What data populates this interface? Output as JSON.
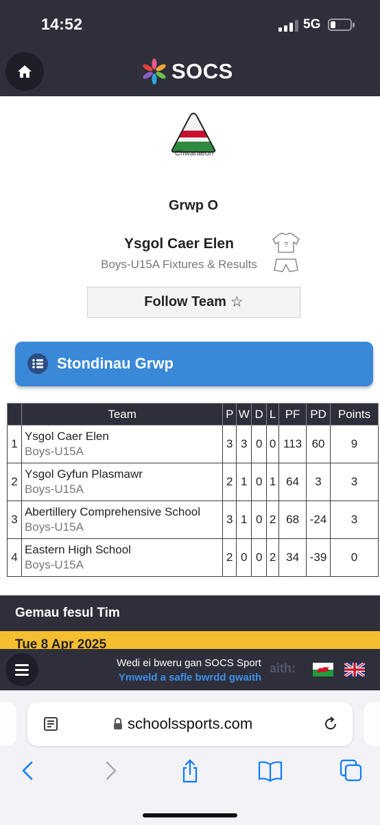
{
  "status_bar": {
    "time": "14:52",
    "network": "5G",
    "battery_level": 0.2
  },
  "app_header": {
    "home_icon": "home-icon",
    "logo_text": "SOCS"
  },
  "crest": {
    "caption": "Chwaraeon",
    "colors": [
      "#2f8a3f",
      "#c8112e",
      "#f2f2f2"
    ]
  },
  "group": {
    "name": "Grwp O"
  },
  "team": {
    "name": "Ysgol Caer Elen",
    "subtitle": "Boys-U15A Fixtures & Results",
    "kit_icons": [
      "shirt-icon",
      "shorts-icon"
    ],
    "shirt_mark": "?"
  },
  "follow_button": {
    "label": "Follow Team",
    "icon": "star-icon"
  },
  "standings_banner": {
    "label": "Stondinau Grwp",
    "icon": "list-icon",
    "color": "#3a89d9"
  },
  "standings": {
    "headers": [
      "",
      "Team",
      "P",
      "W",
      "D",
      "L",
      "PF",
      "PD",
      "Points"
    ],
    "rows": [
      {
        "pos": "1",
        "team": "Ysgol Caer Elen",
        "sub": "Boys-U15A",
        "p": "3",
        "w": "3",
        "d": "0",
        "l": "0",
        "pf": "113",
        "pd": "60",
        "points": "9"
      },
      {
        "pos": "2",
        "team": "Ysgol Gyfun Plasmawr",
        "sub": "Boys-U15A",
        "p": "2",
        "w": "1",
        "d": "0",
        "l": "1",
        "pf": "64",
        "pd": "3",
        "points": "3"
      },
      {
        "pos": "3",
        "team": "Abertillery Comprehensive School",
        "sub": "Boys-U15A",
        "p": "3",
        "w": "1",
        "d": "0",
        "l": "2",
        "pf": "68",
        "pd": "-24",
        "points": "3"
      },
      {
        "pos": "4",
        "team": "Eastern High School",
        "sub": "Boys-U15A",
        "p": "2",
        "w": "0",
        "d": "0",
        "l": "2",
        "pf": "34",
        "pd": "-39",
        "points": "0"
      }
    ]
  },
  "fixtures": {
    "section_title": "Gemau fesul Tim",
    "date": "Tue 8 Apr 2025",
    "date_bar_color": "#f5bd30"
  },
  "footer": {
    "menu_icon": "menu-icon",
    "powered_by": "Wedi ei bweru gan SOCS Sport",
    "visit_link": "Ymweld a safle bwrdd gwaith",
    "ghost_text": "aith:",
    "flags": [
      "wales-flag-icon",
      "uk-flag-icon"
    ]
  },
  "browser": {
    "url": "schoolssports.com",
    "toolbar_icons": [
      "back-icon",
      "forward-icon",
      "share-icon",
      "bookmarks-icon",
      "tabs-icon"
    ],
    "accent": "#0a7aff"
  }
}
